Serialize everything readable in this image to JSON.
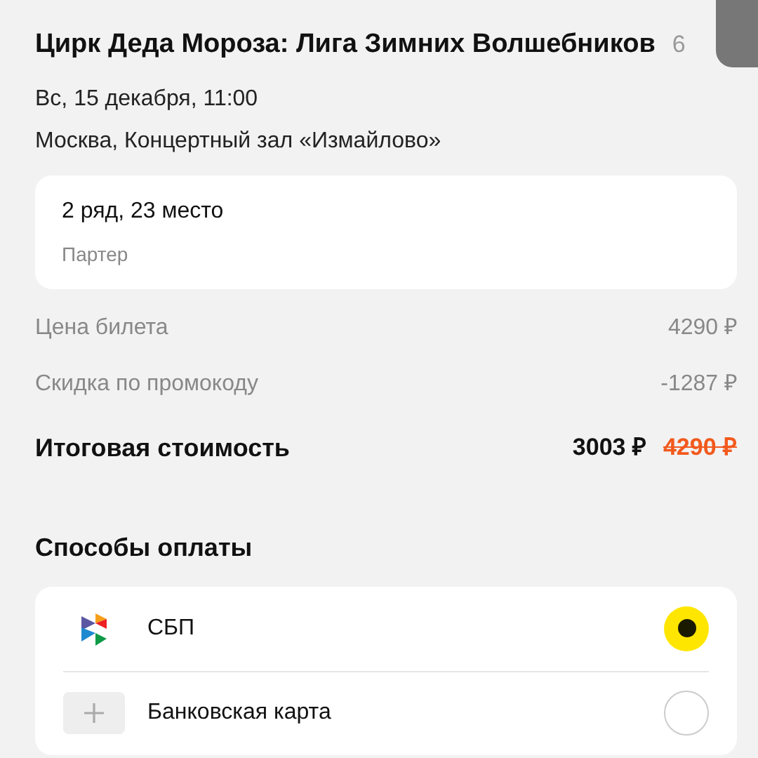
{
  "event": {
    "title": "Цирк Деда Мороза: Лига Зимних Волшебников",
    "cut_text": "6",
    "date": "Вс, 15 декабря, 11:00",
    "venue": "Москва, Концертный зал «Измайлово»"
  },
  "seat": {
    "place": "2 ряд, 23 место",
    "zone": "Партер"
  },
  "lines": [
    {
      "label": "Цена билета",
      "value": "4290 ₽"
    },
    {
      "label": "Скидка по промокоду",
      "value": "-1287 ₽"
    }
  ],
  "total": {
    "label": "Итоговая стоимость",
    "value": "3003 ₽",
    "old_value": "4290 ₽"
  },
  "payment": {
    "title": "Способы оплаты",
    "methods": [
      {
        "kind": "sbp",
        "label": "СБП",
        "selected": true
      },
      {
        "kind": "card",
        "label": "Банковская карта",
        "selected": false
      }
    ]
  }
}
